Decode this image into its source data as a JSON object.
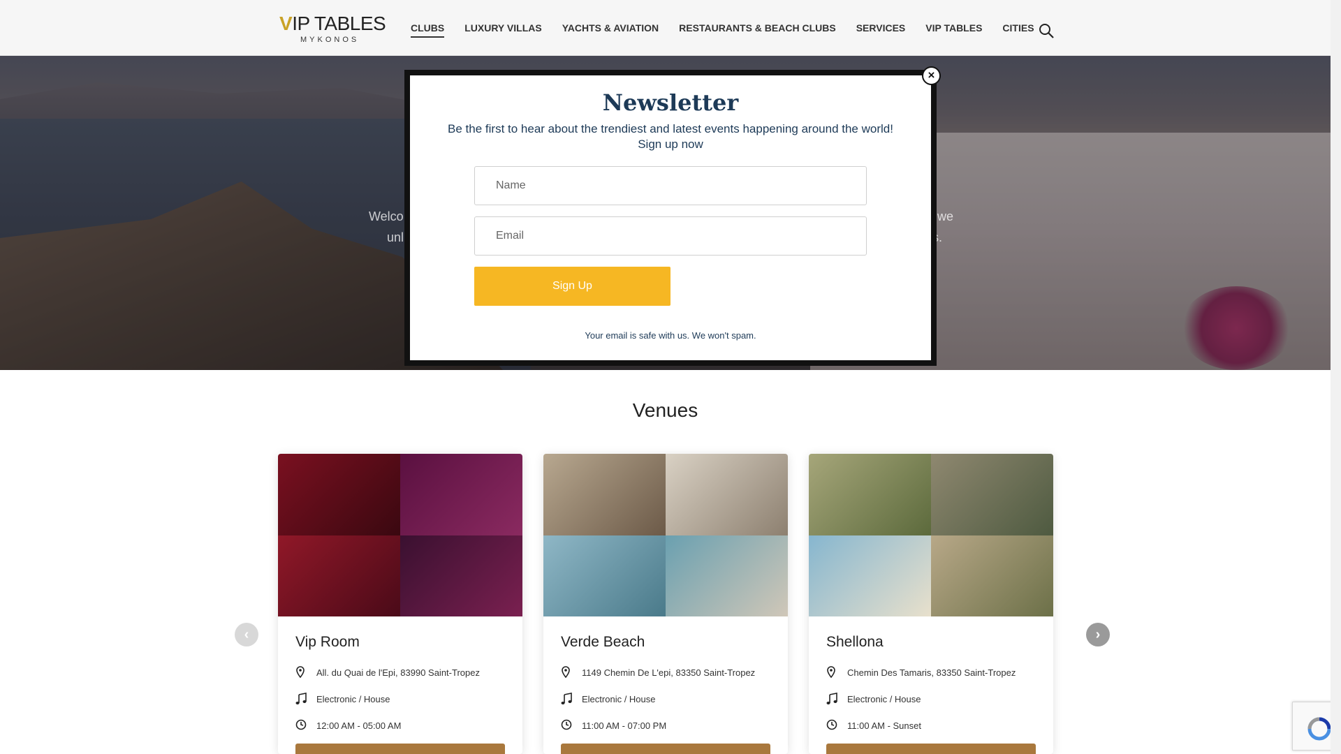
{
  "header": {
    "logo_main": "IP TABLES",
    "logo_v": "V",
    "logo_sub": "MYKONOS",
    "nav": [
      {
        "label": "CLUBS",
        "active": true
      },
      {
        "label": "LUXURY VILLAS"
      },
      {
        "label": "YACHTS & AVIATION"
      },
      {
        "label": "RESTAURANTS & BEACH CLUBS"
      },
      {
        "label": "SERVICES"
      },
      {
        "label": "VIP TABLES"
      },
      {
        "label": "CITIES"
      }
    ],
    "search_icon": "search-icon"
  },
  "hero": {
    "text_left": "Welco",
    "text_left2": "unl",
    "text_right": "e, we",
    "text_right2": "s."
  },
  "newsletter": {
    "title": "Newsletter",
    "subtitle_line1": "Be the first to hear about the trendiest and latest events happening around the world!",
    "subtitle_line2": "Sign up now",
    "name_placeholder": "Name",
    "email_placeholder": "Email",
    "signup_label": "Sign Up",
    "note": "Your email is safe with us. We won't spam.",
    "close_label": "×"
  },
  "venues": {
    "title": "Venues",
    "prev_label": "‹",
    "next_label": "›",
    "cards": [
      {
        "name": "Vip Room",
        "address": "All. du Quai de l'Epi, 83990 Saint-Tropez",
        "genre": "Electronic / House",
        "hours": "12:00 AM - 05:00 AM"
      },
      {
        "name": "Verde Beach",
        "address": "1149 Chemin De L'epi, 83350 Saint-Tropez",
        "genre": "Electronic / House",
        "hours": "11:00 AM - 07:00 PM"
      },
      {
        "name": "Shellona",
        "address": "Chemin Des Tamaris, 83350 Saint-Tropez",
        "genre": "Electronic / House",
        "hours": "11:00 AM - Sunset"
      }
    ]
  },
  "colors": {
    "accent": "#f6b723",
    "navy": "#1d3a57",
    "card_button": "#a9783d"
  }
}
